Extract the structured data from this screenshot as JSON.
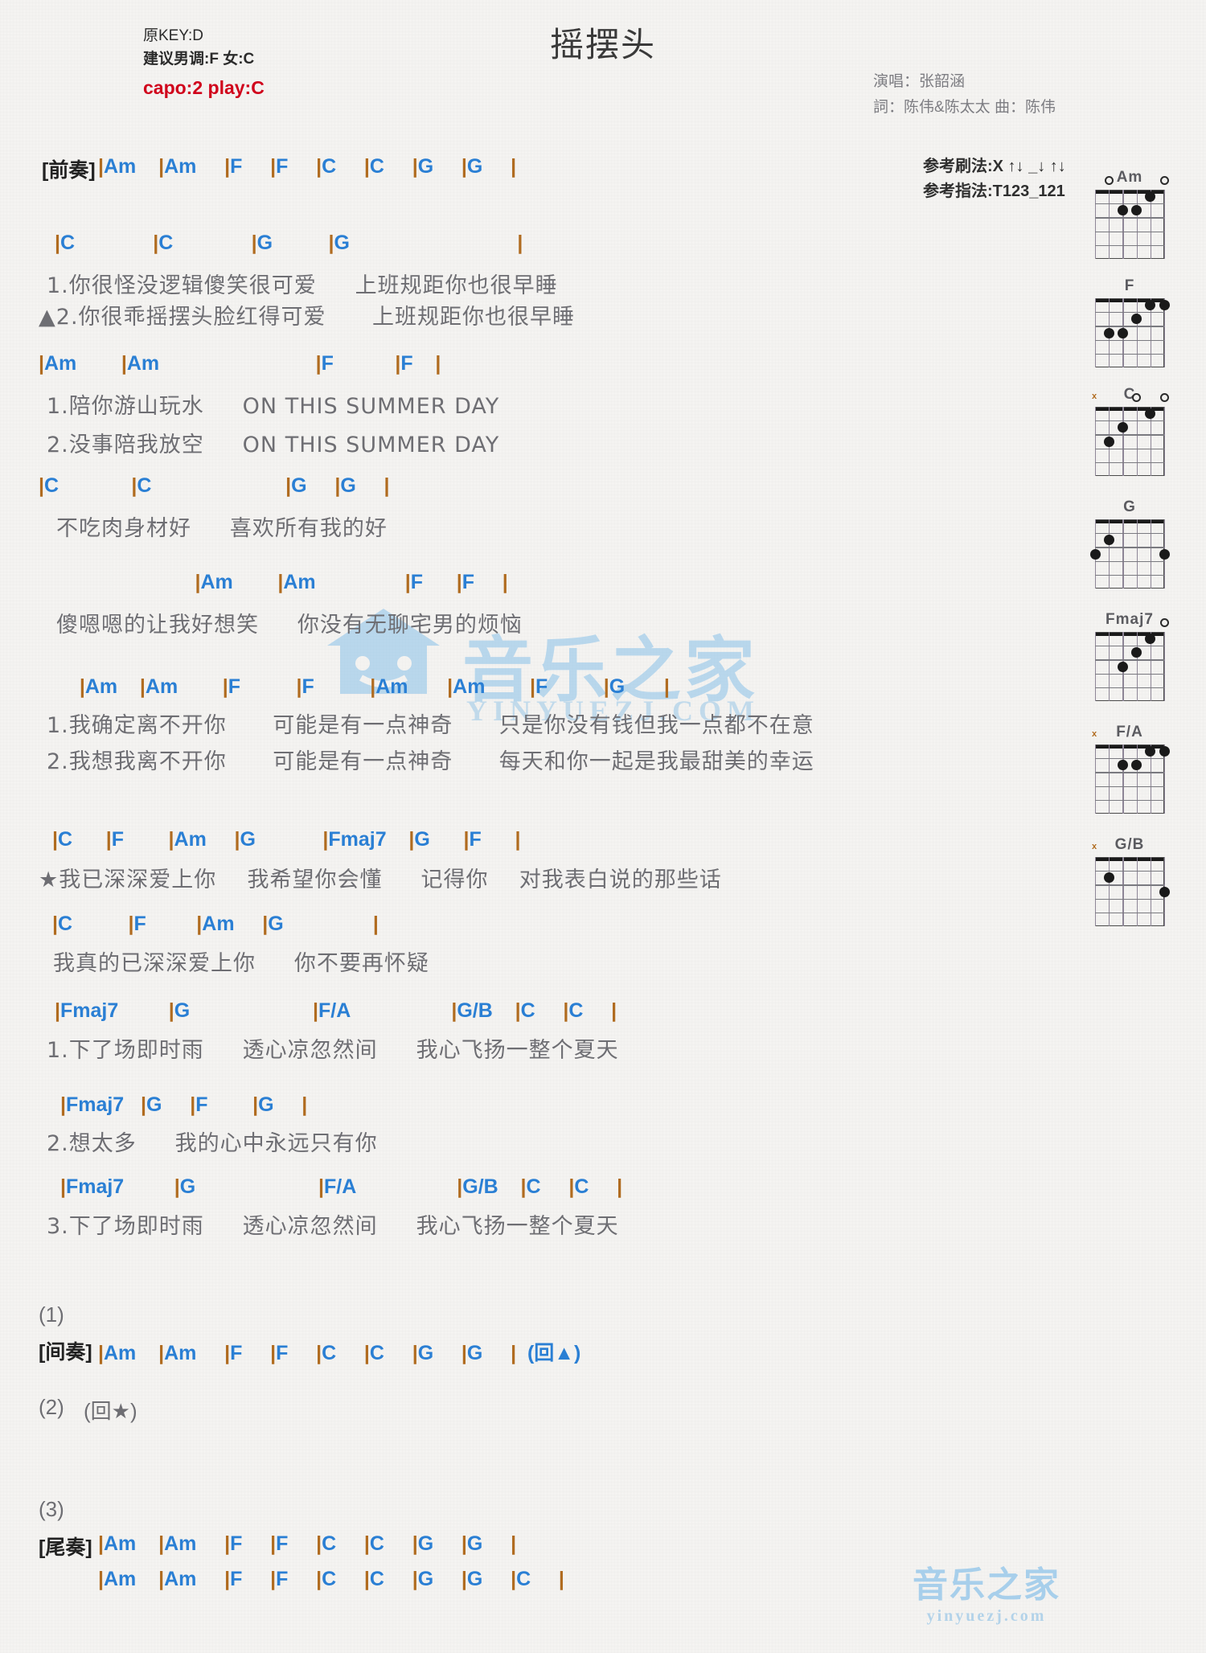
{
  "header": {
    "orig_key": "原KEY:D",
    "suggest": "建议男调:F 女:C",
    "capo": "capo:2 play:C",
    "title": "摇摆头",
    "singer": "演唱：张韶涵",
    "credits": "詞：陈伟&陈太太   曲：陈伟",
    "strum_pattern": "参考刷法:X ↑↓ _↓ ↑↓",
    "finger_pattern": "参考指法:T123_121",
    "capo_color": "#d0021b",
    "chord_color": "#2a7fd4",
    "bar_color": "#b06b1f"
  },
  "sections": {
    "intro_label": "[前奏]",
    "intro_chords": "|Am    |Am     |F     |F     |C     |C     |G     |G     |",
    "v1_chords": "|C              |C              |G          |G                              |",
    "v1_line1": "1.你很怪没逻辑傻笑很可爱     上班规距你也很早睡",
    "v1_line2": "▲2.你很乖摇摆头脸红得可爱      上班规距你也很早睡",
    "v2_chords": "|Am        |Am                            |F           |F    |",
    "v2_line1": "1.陪你游山玩水     ON THIS SUMMER DAY",
    "v2_line2": "2.没事陪我放空     ON THIS SUMMER DAY",
    "v3_chords": "|C             |C                        |G     |G     |",
    "v3_line1": "不吃肉身材好     喜欢所有我的好",
    "v4_chords": "                            |Am        |Am                |F      |F     |",
    "v4_line1": "傻嗯嗯的让我好想笑     你没有无聊宅男的烦恼",
    "c1_chords": "   |Am    |Am        |F          |F          |Am       |Am        |F          |G       |",
    "c1_line1": "1.我确定离不开你      可能是有一点神奇      只是你没有钱但我一点都不在意",
    "c1_line2": "2.我想我离不开你      可能是有一点神奇      每天和你一起是我最甜美的幸运",
    "s1_chords": " |C      |F        |Am     |G            |Fmaj7    |G      |F      |",
    "s1_line1": "★我已深深爱上你    我希望你会懂     记得你    对我表白说的那些话",
    "s2_chords": " |C          |F         |Am     |G                |",
    "s2_line1": "我真的已深深爱上你     你不要再怀疑",
    "s3_chords": "|Fmaj7         |G                      |F/A                  |G/B    |C     |C     |",
    "s3_line1": "1.下了场即时雨     透心凉忽然间     我心飞扬一整个夏天",
    "s4_chords": " |Fmaj7   |G     |F        |G     |",
    "s4_line1": "2.想太多     我的心中永远只有你",
    "s5_chords": " |Fmaj7         |G                      |F/A                  |G/B    |C     |C     |",
    "s5_line1": "3.下了场即时雨     透心凉忽然间     我心飞扬一整个夏天",
    "ending1_num": "(1)",
    "ending1_label": "[间奏]",
    "ending1_chords": "|Am    |Am     |F     |F     |C     |C     |G     |G     |  (回▲)",
    "ending2_num": "(2)",
    "ending2_text": "(回★)",
    "ending3_num": "(3)",
    "ending3_label": "[尾奏]",
    "ending3_chords_line1": "|Am    |Am     |F     |F     |C     |C     |G     |G     |",
    "ending3_chords_line2": "|Am    |Am     |F     |F     |C     |C     |G     |G     |C     |"
  },
  "chord_diagrams": [
    {
      "name": "Am",
      "open": [
        1,
        5
      ],
      "muted": [],
      "dots": [
        [
          2,
          1
        ],
        [
          3,
          2
        ],
        [
          4,
          2
        ]
      ]
    },
    {
      "name": "F",
      "open": [],
      "muted": [],
      "dots": [
        [
          1,
          1
        ],
        [
          2,
          1
        ],
        [
          3,
          2
        ],
        [
          4,
          3
        ],
        [
          5,
          3
        ]
      ],
      "barre": 1
    },
    {
      "name": "C",
      "open": [
        1,
        3
      ],
      "muted": [
        6
      ],
      "dots": [
        [
          2,
          1
        ],
        [
          4,
          2
        ],
        [
          5,
          3
        ]
      ]
    },
    {
      "name": "G",
      "open": [],
      "muted": [],
      "dots": [
        [
          1,
          3
        ],
        [
          5,
          2
        ],
        [
          6,
          3
        ]
      ],
      "barre": 0
    },
    {
      "name": "Fmaj7",
      "open": [
        1
      ],
      "muted": [],
      "dots": [
        [
          2,
          1
        ],
        [
          3,
          2
        ],
        [
          4,
          3
        ]
      ]
    },
    {
      "name": "F/A",
      "open": [],
      "muted": [
        6
      ],
      "dots": [
        [
          1,
          1
        ],
        [
          2,
          1
        ],
        [
          3,
          2
        ],
        [
          4,
          2
        ]
      ],
      "barre": 1
    },
    {
      "name": "G/B",
      "open": [],
      "muted": [
        6
      ],
      "dots": [
        [
          1,
          3
        ],
        [
          5,
          2
        ]
      ]
    }
  ],
  "watermark": {
    "text": "音乐之家",
    "sub": "YINYUEZJ.COM",
    "corner_text": "音乐之家",
    "corner_sub": "yinyuezj.com",
    "color": "#8fc4ea"
  }
}
